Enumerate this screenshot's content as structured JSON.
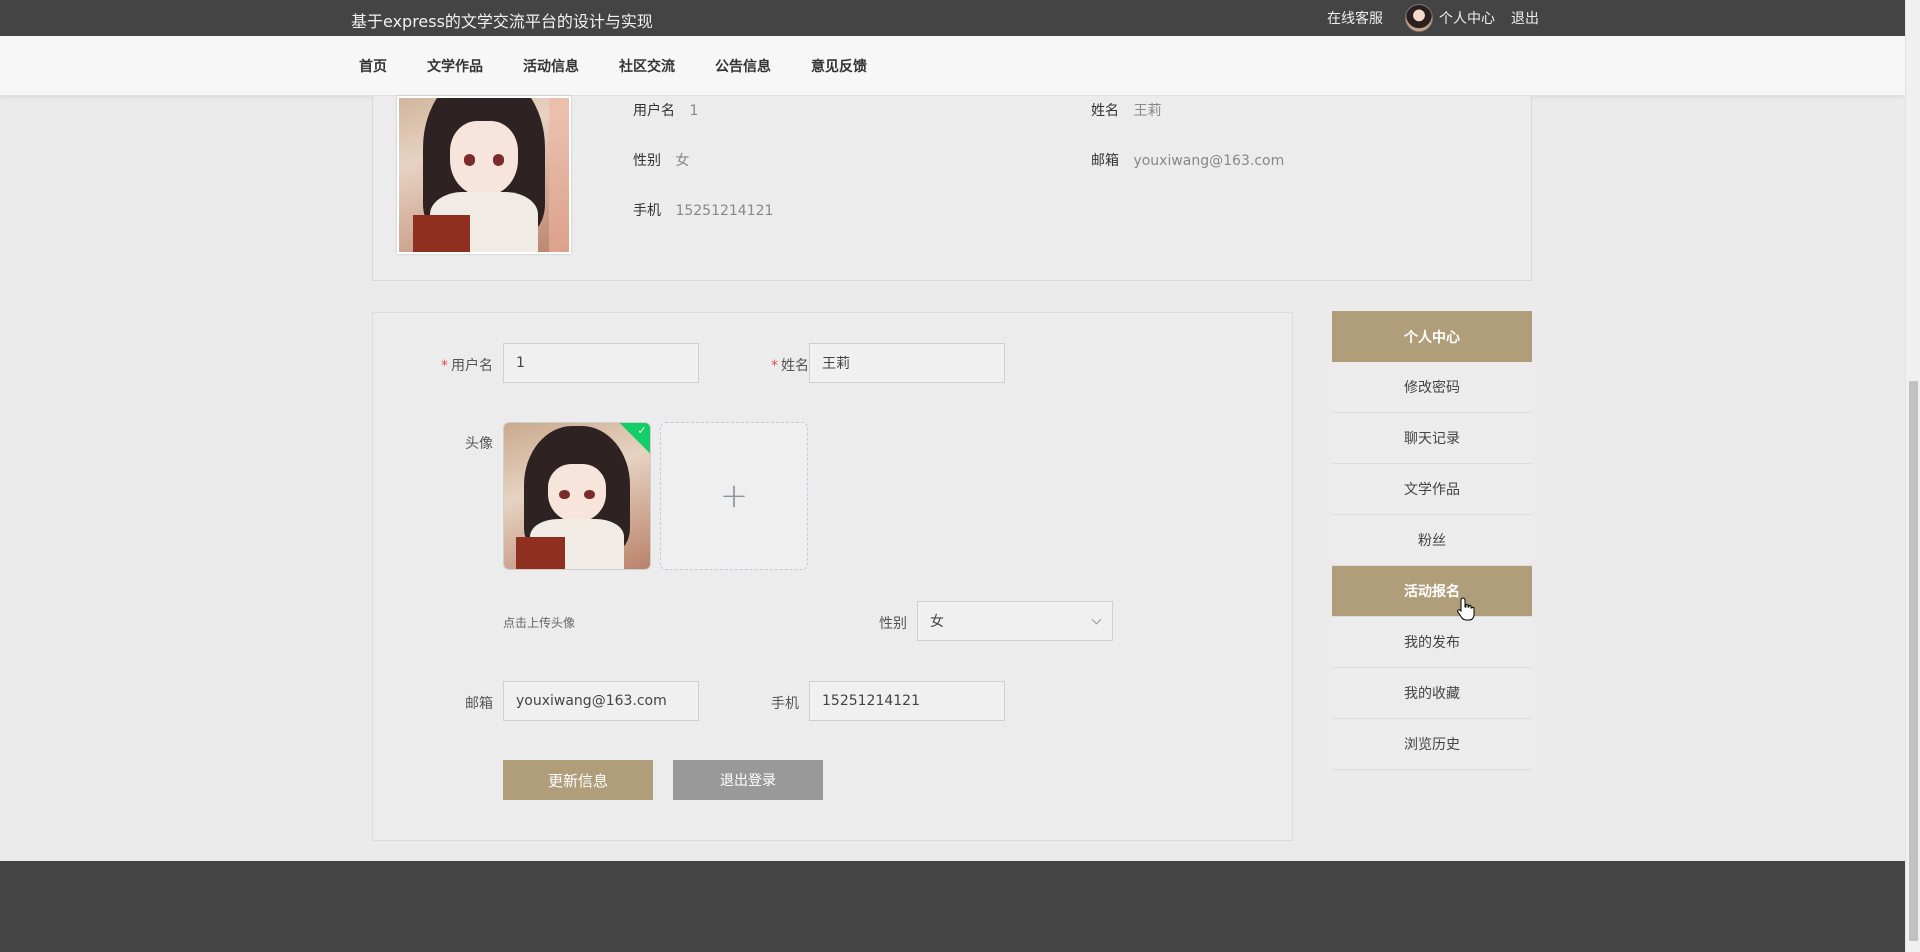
{
  "header": {
    "site_title": "基于express的文学交流平台的设计与实现",
    "online_service": "在线客服",
    "personal_center": "个人中心",
    "logout": "退出"
  },
  "nav": {
    "items": [
      "首页",
      "文学作品",
      "活动信息",
      "社区交流",
      "公告信息",
      "意见反馈"
    ]
  },
  "profile": {
    "username_label": "用户名",
    "username": "1",
    "name_label": "姓名",
    "name": "王莉",
    "gender_label": "性别",
    "gender": "女",
    "email_label": "邮箱",
    "email": "youxiwang@163.com",
    "phone_label": "手机",
    "phone": "15251214121"
  },
  "form": {
    "username_label": "用户名",
    "username_value": "1",
    "name_label": "姓名",
    "name_value": "王莉",
    "avatar_label": "头像",
    "upload_tip": "点击上传头像",
    "gender_label": "性别",
    "gender_value": "女",
    "email_label": "邮箱",
    "email_value": "youxiwang@163.com",
    "phone_label": "手机",
    "phone_value": "15251214121",
    "update_button": "更新信息",
    "logout_button": "退出登录"
  },
  "side_menu": {
    "title": "个人中心",
    "items": [
      "修改密码",
      "聊天记录",
      "文学作品",
      "粉丝",
      "活动报名",
      "我的发布",
      "我的收藏",
      "浏览历史"
    ],
    "active_index": 4
  },
  "colors": {
    "accent": "#b09e7b",
    "topbar": "#444444",
    "success": "#13ce66"
  }
}
